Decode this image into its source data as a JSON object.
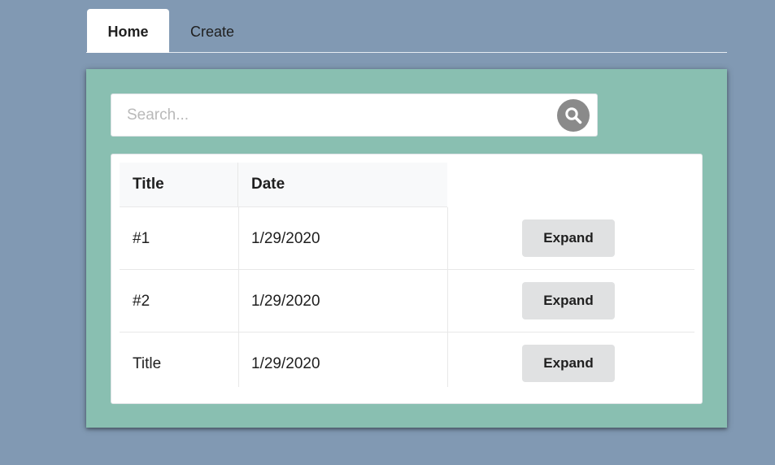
{
  "tabs": [
    {
      "label": "Home",
      "active": true
    },
    {
      "label": "Create",
      "active": false
    }
  ],
  "search": {
    "placeholder": "Search...",
    "value": "",
    "icon": "search-icon"
  },
  "table": {
    "columns": [
      "Title",
      "Date"
    ],
    "rows": [
      {
        "title": "#1",
        "date": "1/29/2020",
        "action": "Expand"
      },
      {
        "title": "#2",
        "date": "1/29/2020",
        "action": "Expand"
      },
      {
        "title": "Title",
        "date": "1/29/2020",
        "action": "Expand"
      }
    ]
  },
  "colors": {
    "page_background": "#8199b3",
    "panel_background": "#89bfb1",
    "button_background": "#e0e1e2",
    "search_button": "#8a8a8a"
  }
}
